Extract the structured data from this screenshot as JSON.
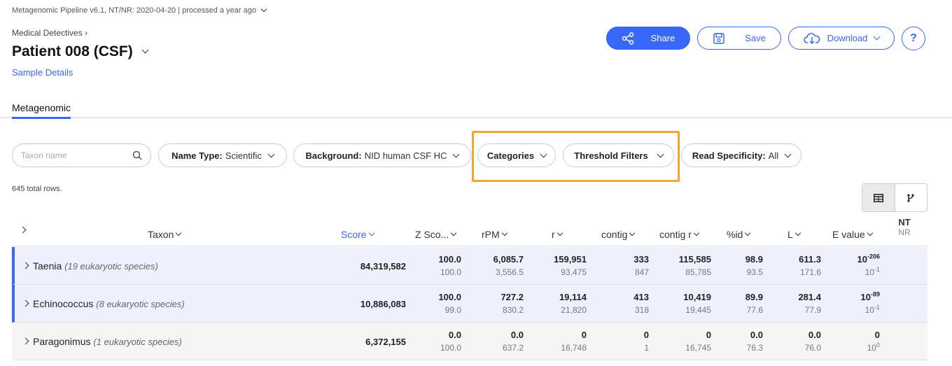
{
  "header": {
    "pipeline_text": "Metagenomic Pipeline v6.1, NT/NR: 2020-04-20 | processed a year ago",
    "breadcrumb": "Medical Detectives ›",
    "title": "Patient 008 (CSF)",
    "sample_details": "Sample Details"
  },
  "actions": {
    "share": "Share",
    "save": "Save",
    "download": "Download",
    "help": "?"
  },
  "tabs": {
    "metagenomic": "Metagenomic"
  },
  "filters": {
    "search_placeholder": "Taxon name",
    "name_type_label": "Name Type:",
    "name_type_value": "Scientific",
    "background_label": "Background:",
    "background_value": "NID human CSF HC",
    "categories": "Categories",
    "threshold": "Threshold Filters",
    "read_spec_label": "Read Specificity:",
    "read_spec_value": "All"
  },
  "total_rows": "645 total rows.",
  "table": {
    "headers": {
      "taxon": "Taxon",
      "score": "Score",
      "zscore": "Z Sco...",
      "rpm": "rPM",
      "r": "r",
      "contig": "contig",
      "contig_r": "contig r",
      "pid": "%id",
      "L": "L",
      "evalue": "E value",
      "nt": "NT",
      "nr": "NR"
    },
    "rows": [
      {
        "name": "Taenia",
        "desc": "(19 eukaryotic species)",
        "score": "84,319,582",
        "zscore": [
          "100.0",
          "100.0"
        ],
        "rpm": [
          "6,085.7",
          "3,556.5"
        ],
        "r": [
          "159,951",
          "93,475"
        ],
        "contig": [
          "333",
          "847"
        ],
        "contig_r": [
          "115,585",
          "85,785"
        ],
        "pid": [
          "98.9",
          "93.5"
        ],
        "L": [
          "611.3",
          "171.6"
        ],
        "evalue": [
          [
            "10",
            "-206"
          ],
          [
            "10",
            "-1"
          ]
        ]
      },
      {
        "name": "Echinococcus",
        "desc": "(8 eukaryotic species)",
        "score": "10,886,083",
        "zscore": [
          "100.0",
          "99.0"
        ],
        "rpm": [
          "727.2",
          "830.2"
        ],
        "r": [
          "19,114",
          "21,820"
        ],
        "contig": [
          "413",
          "318"
        ],
        "contig_r": [
          "10,419",
          "19,445"
        ],
        "pid": [
          "89.9",
          "77.6"
        ],
        "L": [
          "281.4",
          "77.9"
        ],
        "evalue": [
          [
            "10",
            "-89"
          ],
          [
            "10",
            "-1"
          ]
        ]
      },
      {
        "name": "Paragonimus",
        "desc": "(1 eukaryotic species)",
        "score": "6,372,155",
        "zscore": [
          "0.0",
          "100.0"
        ],
        "rpm": [
          "0.0",
          "637.2"
        ],
        "r": [
          "0",
          "16,748"
        ],
        "contig": [
          "0",
          "1"
        ],
        "contig_r": [
          "0",
          "16,745"
        ],
        "pid": [
          "0.0",
          "76.3"
        ],
        "L": [
          "0.0",
          "76.0"
        ],
        "evalue": [
          [
            "0",
            ""
          ],
          [
            "10",
            "0"
          ]
        ]
      }
    ]
  }
}
